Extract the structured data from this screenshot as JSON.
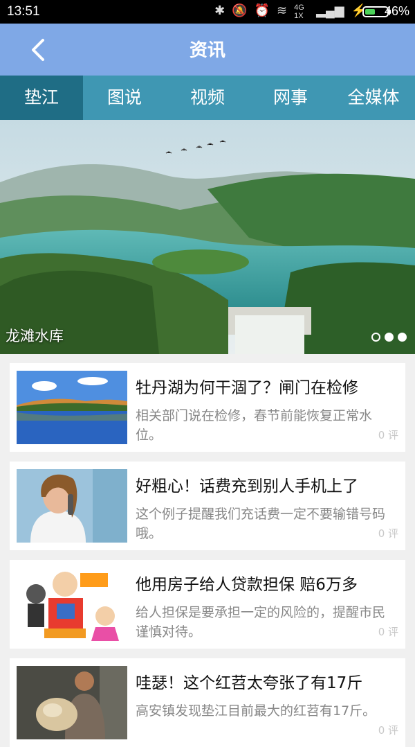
{
  "status_bar": {
    "time": "13:51",
    "network": "4G 1X",
    "battery_pct": "46%",
    "battery_level": 0.46
  },
  "header": {
    "title": "资讯",
    "back_icon": "chevron-left-icon"
  },
  "tabs": [
    {
      "label": "垫江",
      "active": true
    },
    {
      "label": "图说",
      "active": false
    },
    {
      "label": "视频",
      "active": false
    },
    {
      "label": "网事",
      "active": false
    },
    {
      "label": "全媒体",
      "active": false
    }
  ],
  "banner": {
    "caption": "龙滩水库",
    "slides": 3,
    "current_slide": 2
  },
  "news": [
    {
      "headline": "牡丹湖为何干涸了？闸门在检修",
      "summary": "相关部门说在检修，春节前能恢复正常水位。",
      "comments": "0 评"
    },
    {
      "headline": "好粗心！话费充到别人手机上了",
      "summary": "这个例子提醒我们充话费一定不要输错号码哦。",
      "comments": "0 评"
    },
    {
      "headline": "他用房子给人贷款担保 赔6万多",
      "summary": "给人担保是要承担一定的风险的，提醒市民谨慎对待。",
      "comments": "0 评"
    },
    {
      "headline": "哇瑟！这个红苕太夸张了有17斤",
      "summary": "高安镇发现垫江目前最大的红苕有17斤。",
      "comments": "0 评"
    }
  ],
  "colors": {
    "appbar": "#7fa8e6",
    "tabbar": "#3f97b3",
    "tab_active": "#1f6d85"
  }
}
